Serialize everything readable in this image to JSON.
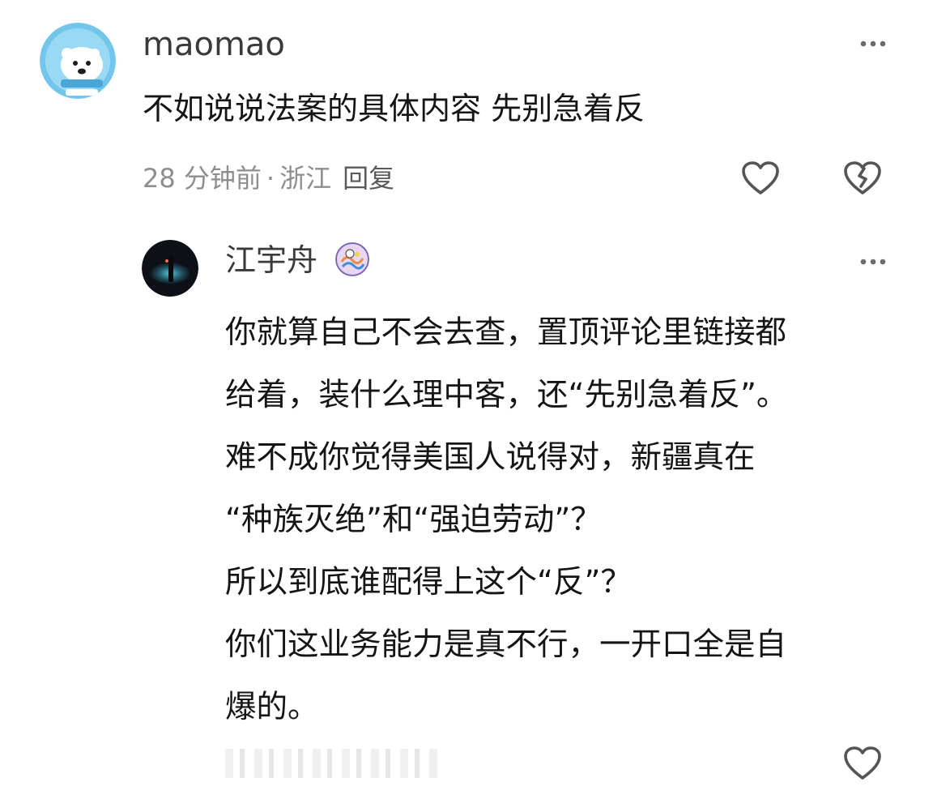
{
  "comment": {
    "username": "maomao",
    "text": "不如说说法案的具体内容 先别急着反",
    "time": "28 分钟前",
    "separator": "·",
    "location": "浙江",
    "reply_label": "回复"
  },
  "reply": {
    "username": "江宇舟",
    "lines": [
      "你就算自己不会去查，置顶评论里链接都",
      "给着，装什么理中客，还“先别急着反”。",
      "难不成你觉得美国人说得对，新疆真在",
      "“种族灭绝”和“强迫劳动”？",
      "所以到底谁配得上这个“反”？",
      "你们这业务能力是真不行，一开口全是自",
      "爆的。"
    ]
  },
  "icons": {
    "more": "more-dots-icon",
    "like": "heart-icon",
    "dislike": "broken-heart-icon"
  },
  "colors": {
    "text_primary": "#151515",
    "username": "#3a3a3a",
    "meta": "#8e8e8e",
    "icon": "#555555",
    "avatar1_bg": "#6fc3ea"
  }
}
